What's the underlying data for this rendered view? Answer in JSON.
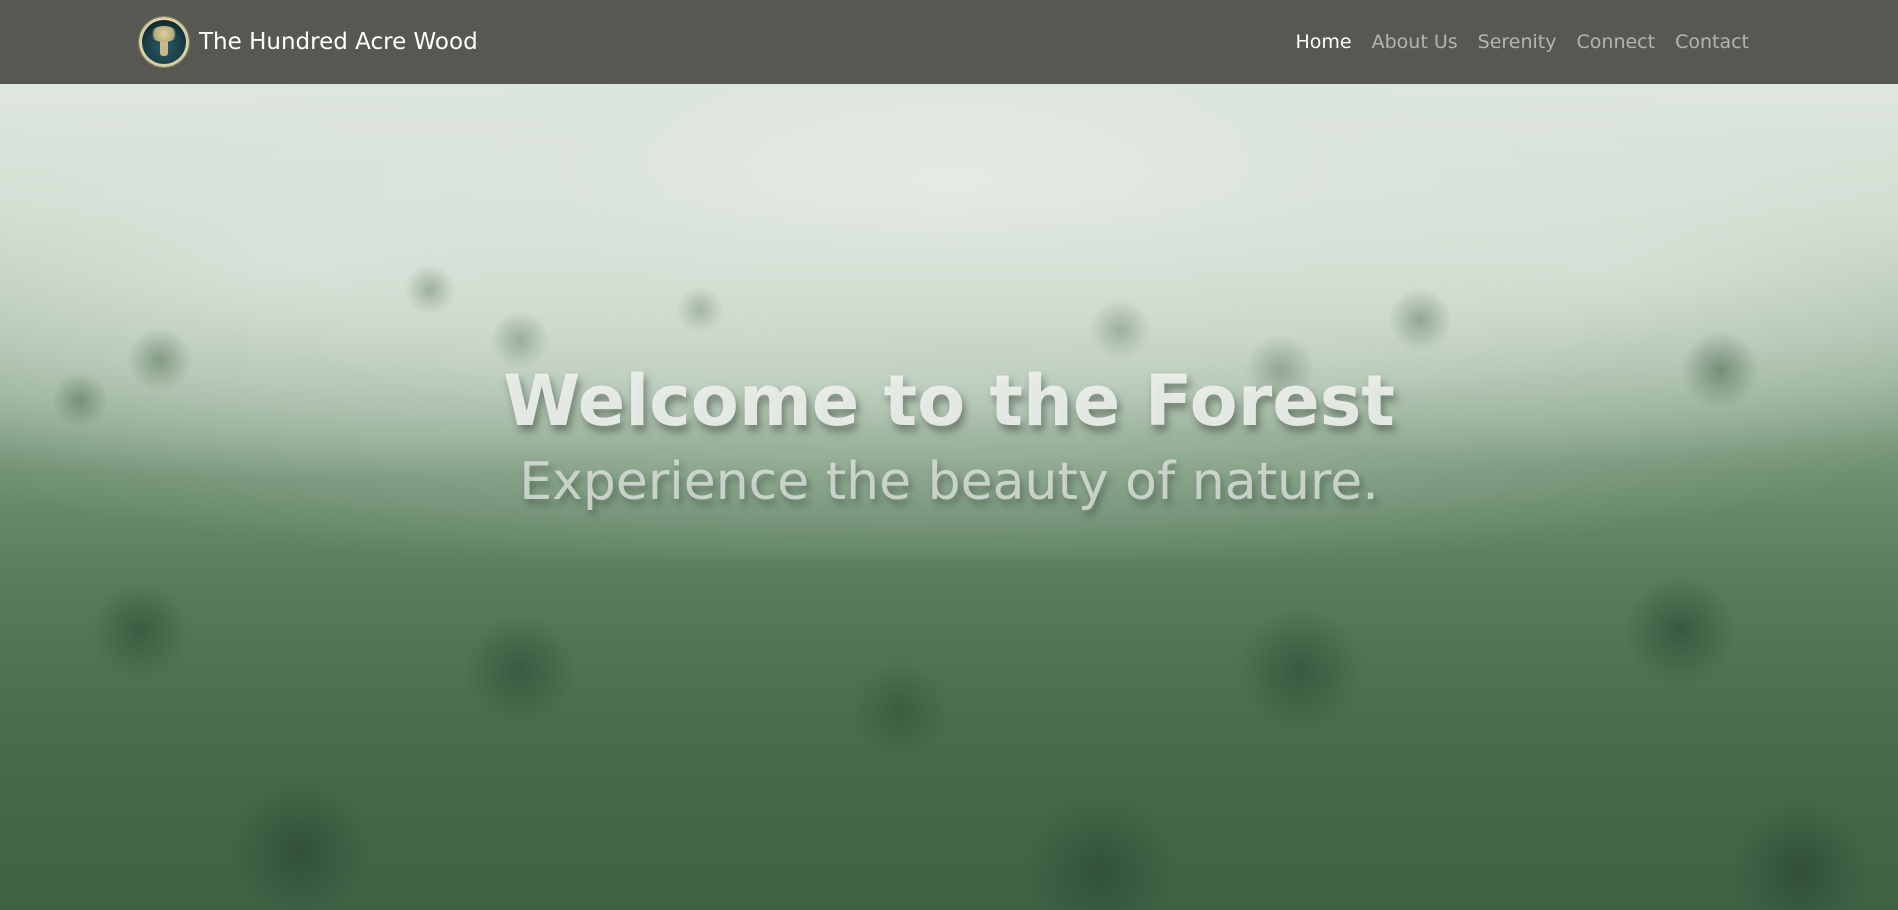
{
  "navbar": {
    "brand": {
      "name": "The Hundred Acre Wood",
      "logo_icon": "tree-emblem-icon"
    },
    "links": [
      {
        "label": "Home",
        "active": true
      },
      {
        "label": "About Us",
        "active": false
      },
      {
        "label": "Serenity",
        "active": false
      },
      {
        "label": "Connect",
        "active": false
      },
      {
        "label": "Contact",
        "active": false
      }
    ]
  },
  "hero": {
    "title": "Welcome to the Forest",
    "subtitle": "Experience the beauty of nature."
  },
  "colors": {
    "navbar_bg": "#484842",
    "nav_active": "#ffffff",
    "nav_inactive": "#a8a8a4",
    "hero_text": "#eceaea"
  }
}
